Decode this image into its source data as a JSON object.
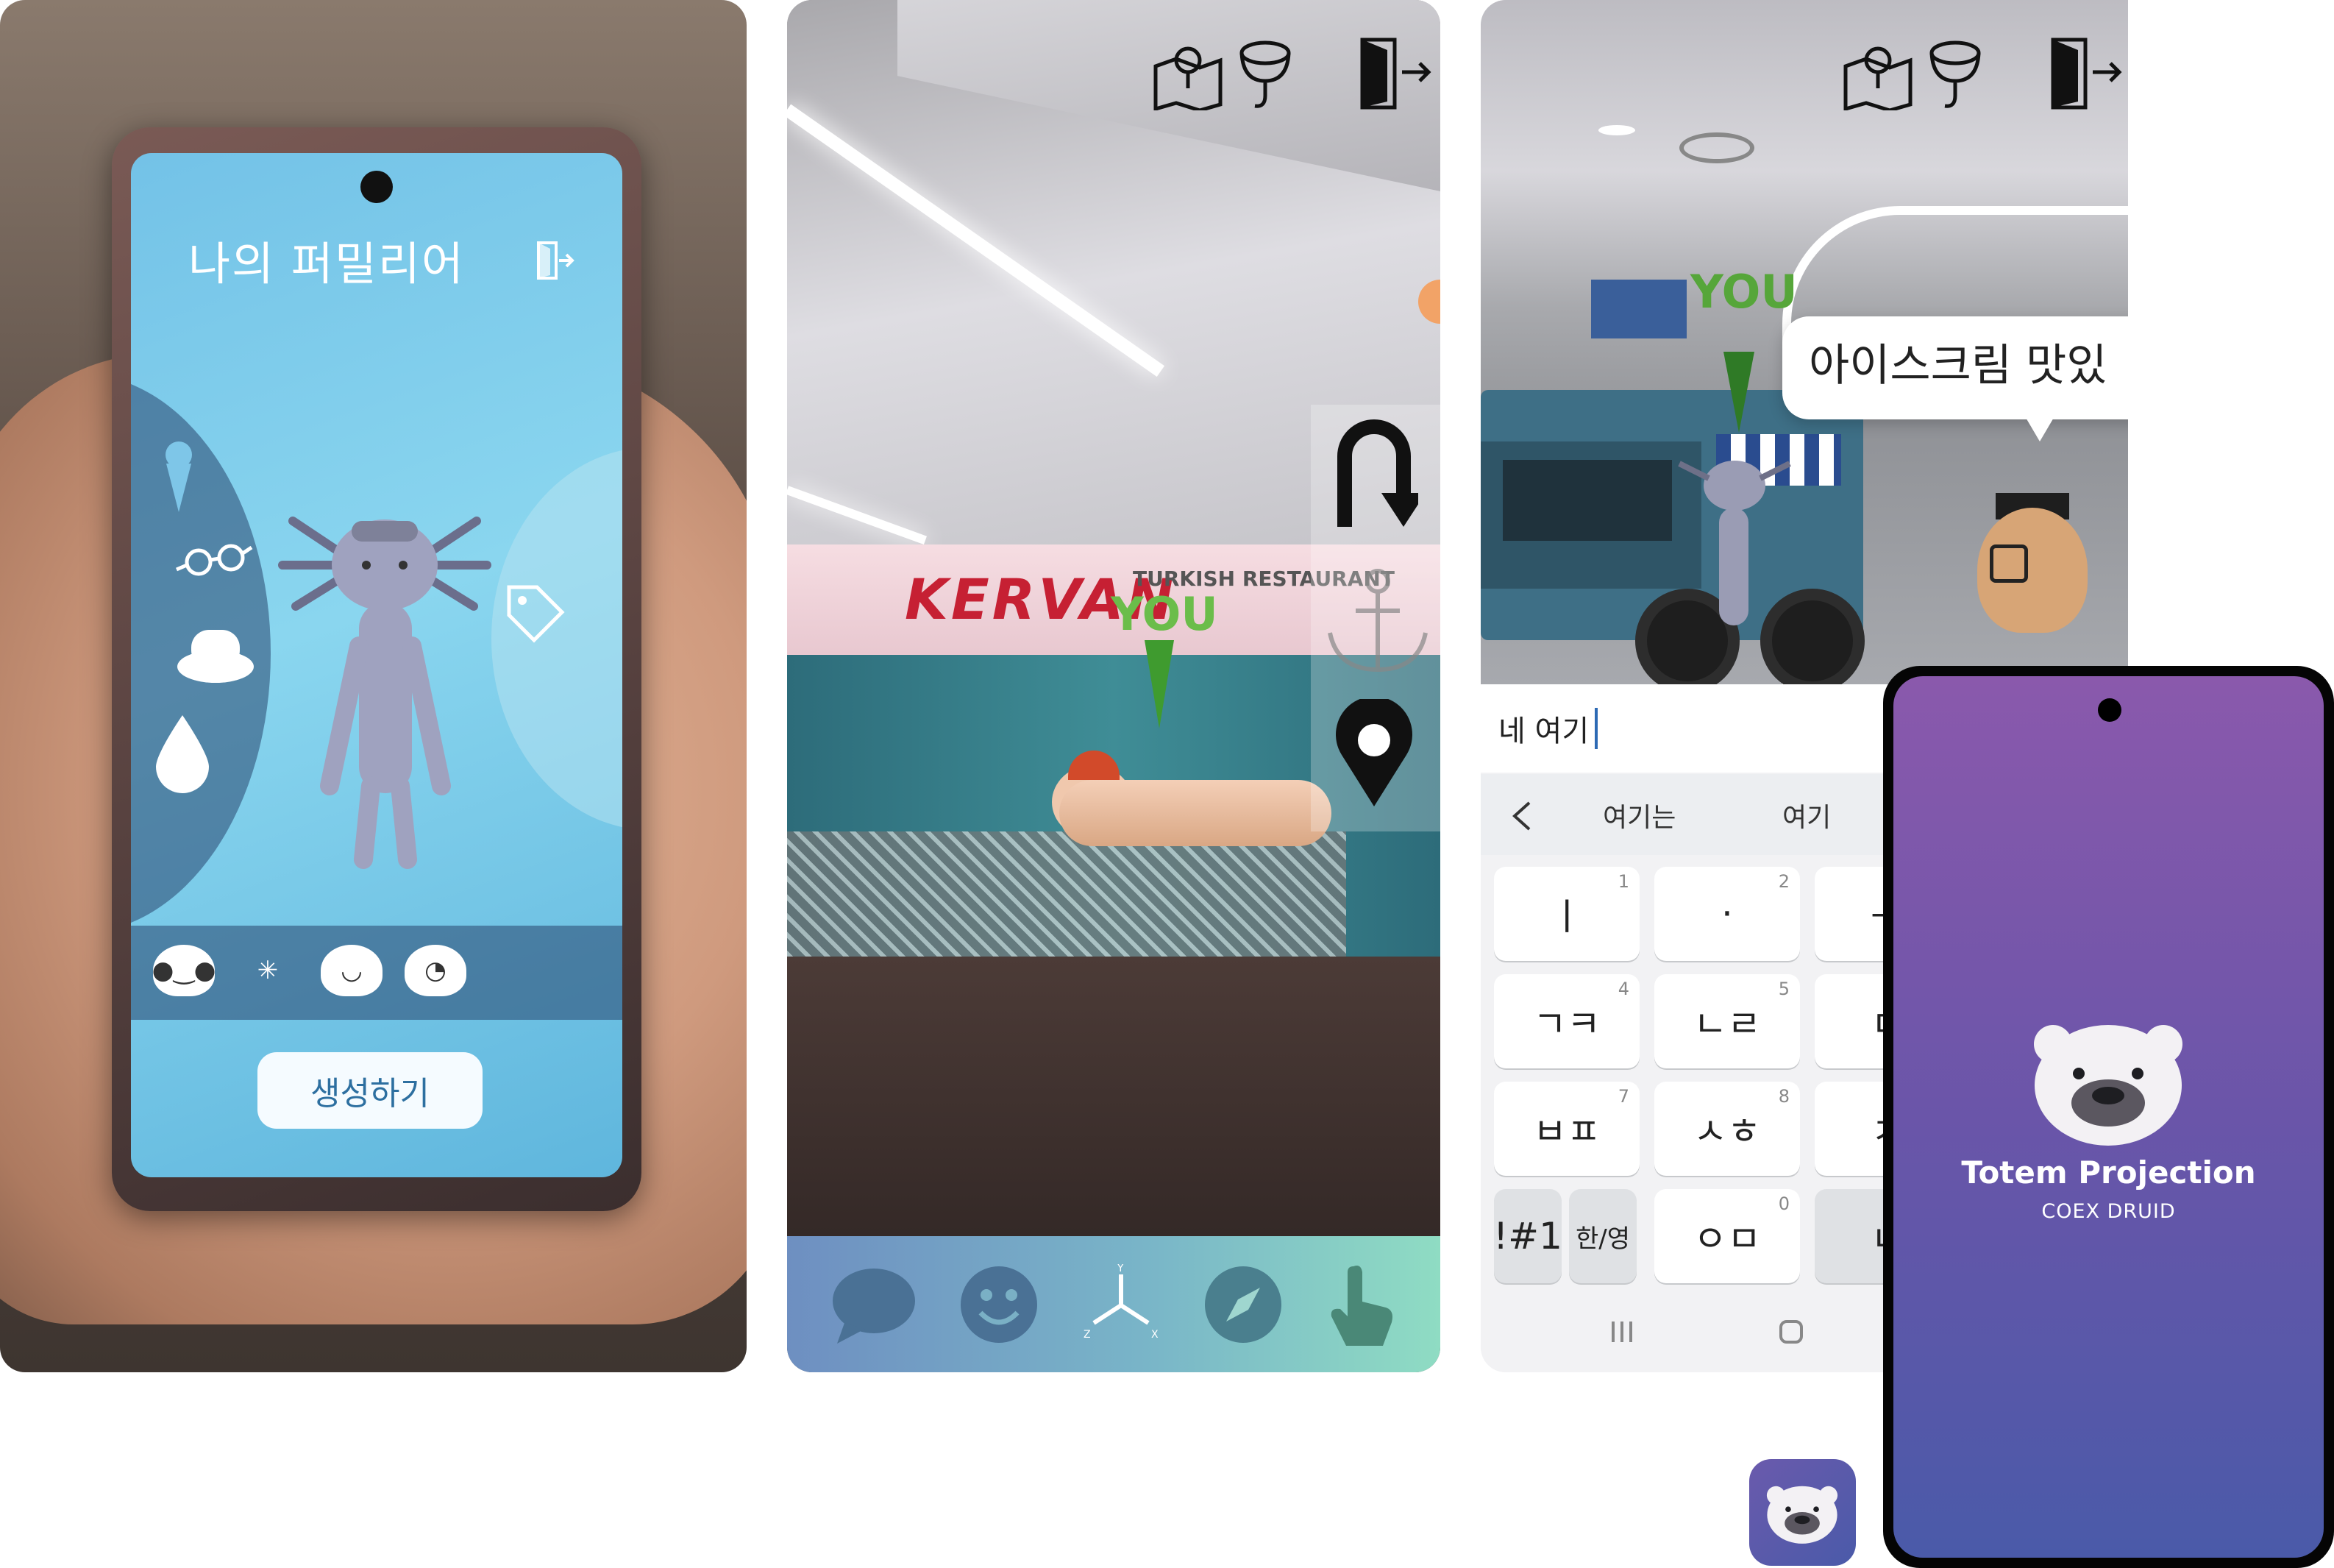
{
  "familiar_screen": {
    "title": "나의 퍼밀리어",
    "create_button": "생성하기",
    "icons": [
      "exit-icon",
      "ice-cream-icon",
      "glasses-icon",
      "hat-icon",
      "drop-icon",
      "tag-icon"
    ],
    "face_options": [
      "bear-face",
      "axolotl-face",
      "round-face",
      "ghost-face"
    ]
  },
  "ar_nav_screen": {
    "store_name": "KERVAN",
    "store_subtitle": "TURKISH RESTAURANT",
    "you_label": "YOU",
    "top_icons": [
      "map-icon",
      "search-icon",
      "exit-icon"
    ],
    "side_icons": [
      "u-turn-icon",
      "anchor-icon",
      "location-pin-icon"
    ],
    "bottom_icons": [
      "chat-icon",
      "emoji-icon",
      "axes-icon",
      "compass-icon",
      "touch-icon"
    ],
    "axis_labels": {
      "y": "Y",
      "z": "Z",
      "x": "X"
    }
  },
  "ar_chat_screen": {
    "you_label": "YOU",
    "speech_bubble": "아이스크림 맛있",
    "input_text": "네 여기",
    "suggestions": [
      "여기는",
      "여기"
    ],
    "keys": [
      {
        "label": "ㅣ",
        "num": "1"
      },
      {
        "label": "·",
        "num": "2"
      },
      {
        "label": "ㄱㅋ",
        "num": "4"
      },
      {
        "label": "ㄴㄹ",
        "num": "5"
      },
      {
        "label": "ㅂㅍ",
        "num": "7"
      },
      {
        "label": "ㅅㅎ",
        "num": "8"
      },
      {
        "label": "!#1",
        "num": ""
      },
      {
        "label": "한/영",
        "num": ""
      },
      {
        "label": "ㅇㅁ",
        "num": "0"
      }
    ],
    "partial_keys": [
      "ㅡ",
      "ㄷ",
      "ㅈ",
      "ㄴ"
    ],
    "nav_icons": [
      "recent-apps-icon",
      "home-icon"
    ]
  },
  "splash_screen": {
    "app_name": "Totem Projection",
    "subtitle": "COEX DRUID"
  },
  "colors": {
    "you_green": "#56a63a",
    "splash_top": "#8a59ac",
    "splash_bottom": "#4a5aa9",
    "bottom_bar_left": "#6e8fc1",
    "bottom_bar_right": "#8fdcc3"
  }
}
